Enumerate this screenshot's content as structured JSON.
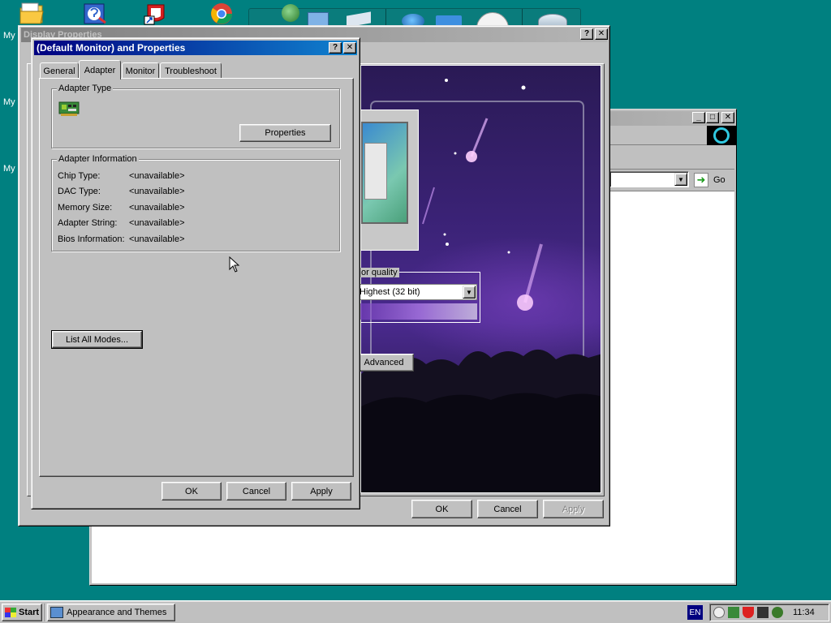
{
  "desktop": {
    "labels": [
      "My",
      "My",
      "My"
    ],
    "icons": [
      "folder-icon",
      "help-icon",
      "shortcut-icon",
      "browser-icon"
    ],
    "toolbar_icons": [
      "globe-icon",
      "app-icon",
      "document-icon",
      "globe-icon",
      "clock-icon",
      "recycle-bin-icon"
    ]
  },
  "display_window": {
    "title": "Display Properties",
    "help": "?",
    "close": "✕",
    "color_quality_label": "or quality",
    "color_quality_value": "Highest (32 bit)",
    "advanced_label": "Advanced",
    "ok_label": "OK",
    "cancel_label": "Cancel",
    "apply_label": "Apply"
  },
  "explorer_window": {
    "go_label": "Go",
    "minimize": "_",
    "maximize": "□",
    "close": "✕"
  },
  "adapter_dialog": {
    "title": "(Default Monitor) and  Properties",
    "help": "?",
    "close": "✕",
    "tabs": [
      {
        "label": "General",
        "active": false
      },
      {
        "label": "Adapter",
        "active": true
      },
      {
        "label": "Monitor",
        "active": false
      },
      {
        "label": "Troubleshoot",
        "active": false
      }
    ],
    "adapter_type_group": "Adapter Type",
    "properties_label": "Properties",
    "adapter_info_group": "Adapter Information",
    "info": [
      {
        "label": "Chip Type:",
        "value": "<unavailable>"
      },
      {
        "label": "DAC Type:",
        "value": "<unavailable>"
      },
      {
        "label": "Memory Size:",
        "value": "<unavailable>"
      },
      {
        "label": "Adapter String:",
        "value": "<unavailable>"
      },
      {
        "label": "Bios Information:",
        "value": "<unavailable>"
      }
    ],
    "list_modes_label": "List All Modes...",
    "ok_label": "OK",
    "cancel_label": "Cancel",
    "apply_label": "Apply"
  },
  "taskbar": {
    "start_label": "Start",
    "task_label": "Appearance and Themes",
    "language": "EN",
    "clock": "11:34",
    "tray_icons": [
      "volume-icon",
      "network-icon",
      "shield-icon",
      "usb-icon",
      "security-icon"
    ]
  },
  "colors": {
    "desktop": "#008080",
    "active_title": "#000080",
    "inactive_title": "#808080",
    "face": "#c0c0c0"
  }
}
